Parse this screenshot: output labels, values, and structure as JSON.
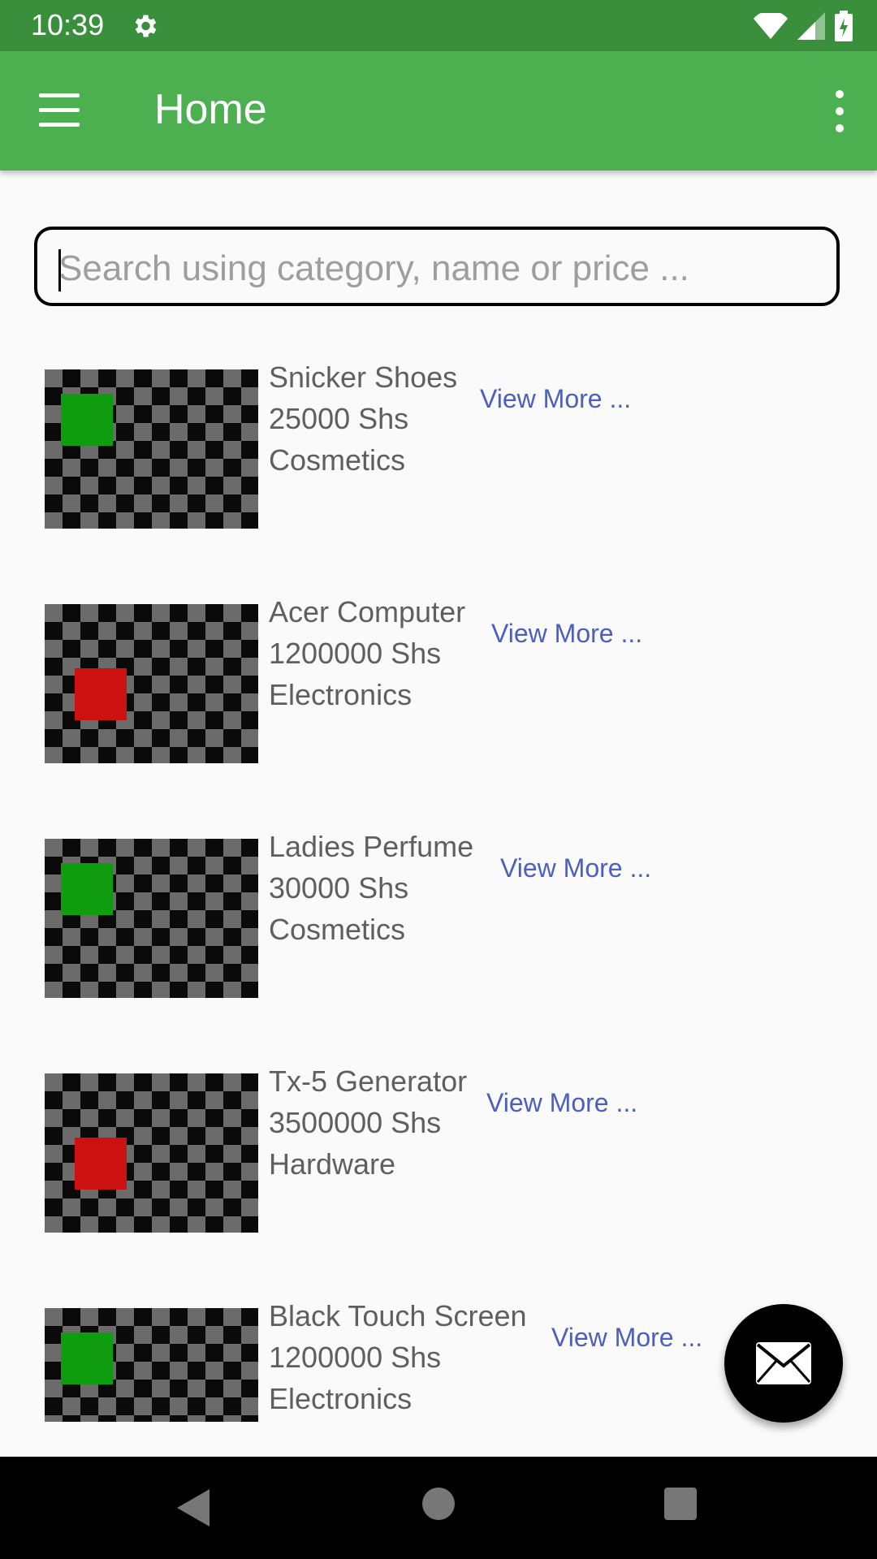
{
  "status_bar": {
    "time": "10:39"
  },
  "app_bar": {
    "title": "Home"
  },
  "search": {
    "placeholder": "Search using category, name or price ..."
  },
  "products": [
    {
      "name": "Snicker Shoes",
      "price": "25000 Shs",
      "category": "Cosmetics",
      "link": "View More ...",
      "thumb_color": "#0f9d0f"
    },
    {
      "name": "Acer Computer",
      "price": "1200000 Shs",
      "category": "Electronics",
      "link": "View More ...",
      "thumb_color": "#cc1111"
    },
    {
      "name": "Ladies Perfume",
      "price": "30000 Shs",
      "category": "Cosmetics",
      "link": "View More ...",
      "thumb_color": "#0f9d0f"
    },
    {
      "name": "Tx-5 Generator",
      "price": "3500000 Shs",
      "category": "Hardware",
      "link": "View More ...",
      "thumb_color": "#cc1111"
    },
    {
      "name": "Black Touch Screen",
      "price": "1200000 Shs",
      "category": "Electronics",
      "link": "View More ...",
      "thumb_color": "#0f9d0f"
    }
  ],
  "fab": {
    "icon": "mail-icon"
  },
  "colors": {
    "status_bar": "#3a8f3c",
    "app_bar": "#4caf50",
    "link": "#4a5fbf"
  }
}
